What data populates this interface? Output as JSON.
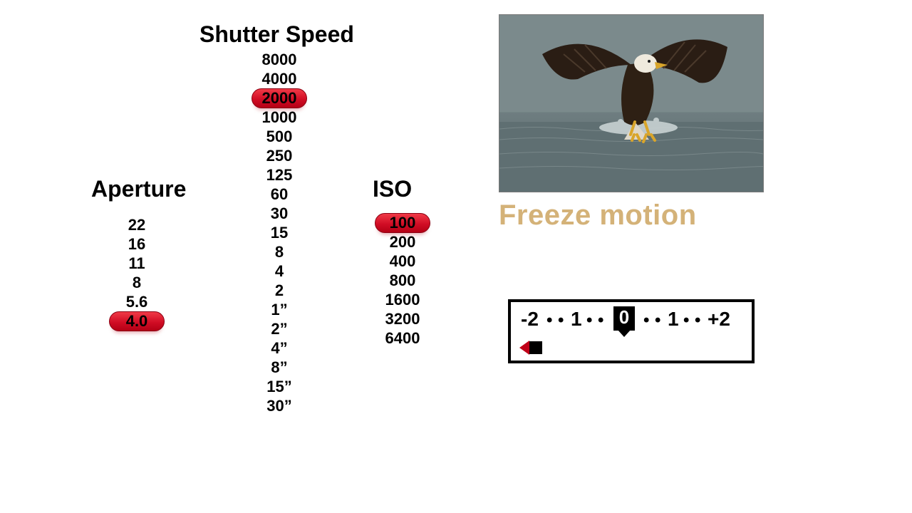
{
  "aperture": {
    "title": "Aperture",
    "values": [
      "22",
      "16",
      "11",
      "8",
      "5.6",
      "4.0"
    ],
    "selected": "4.0"
  },
  "shutter": {
    "title": "Shutter Speed",
    "values": [
      "8000",
      "4000",
      "2000",
      "1000",
      "500",
      "250",
      "125",
      "60",
      "30",
      "15",
      "8",
      "4",
      "2",
      "1”",
      "2”",
      "4”",
      "8”",
      "15”",
      "30”"
    ],
    "selected": "2000"
  },
  "iso": {
    "title": "ISO",
    "values": [
      "100",
      "200",
      "400",
      "800",
      "1600",
      "3200",
      "6400"
    ],
    "selected": "100"
  },
  "caption": "Freeze motion",
  "meter": {
    "left_end": "-2",
    "mid_left": "1",
    "zero": "0",
    "mid_right": "1",
    "right_end": "+2",
    "dot": "•",
    "indicator_position": "far-left-underexposed"
  },
  "photo": {
    "subject": "bald-eagle-catching-fish-over-water"
  }
}
